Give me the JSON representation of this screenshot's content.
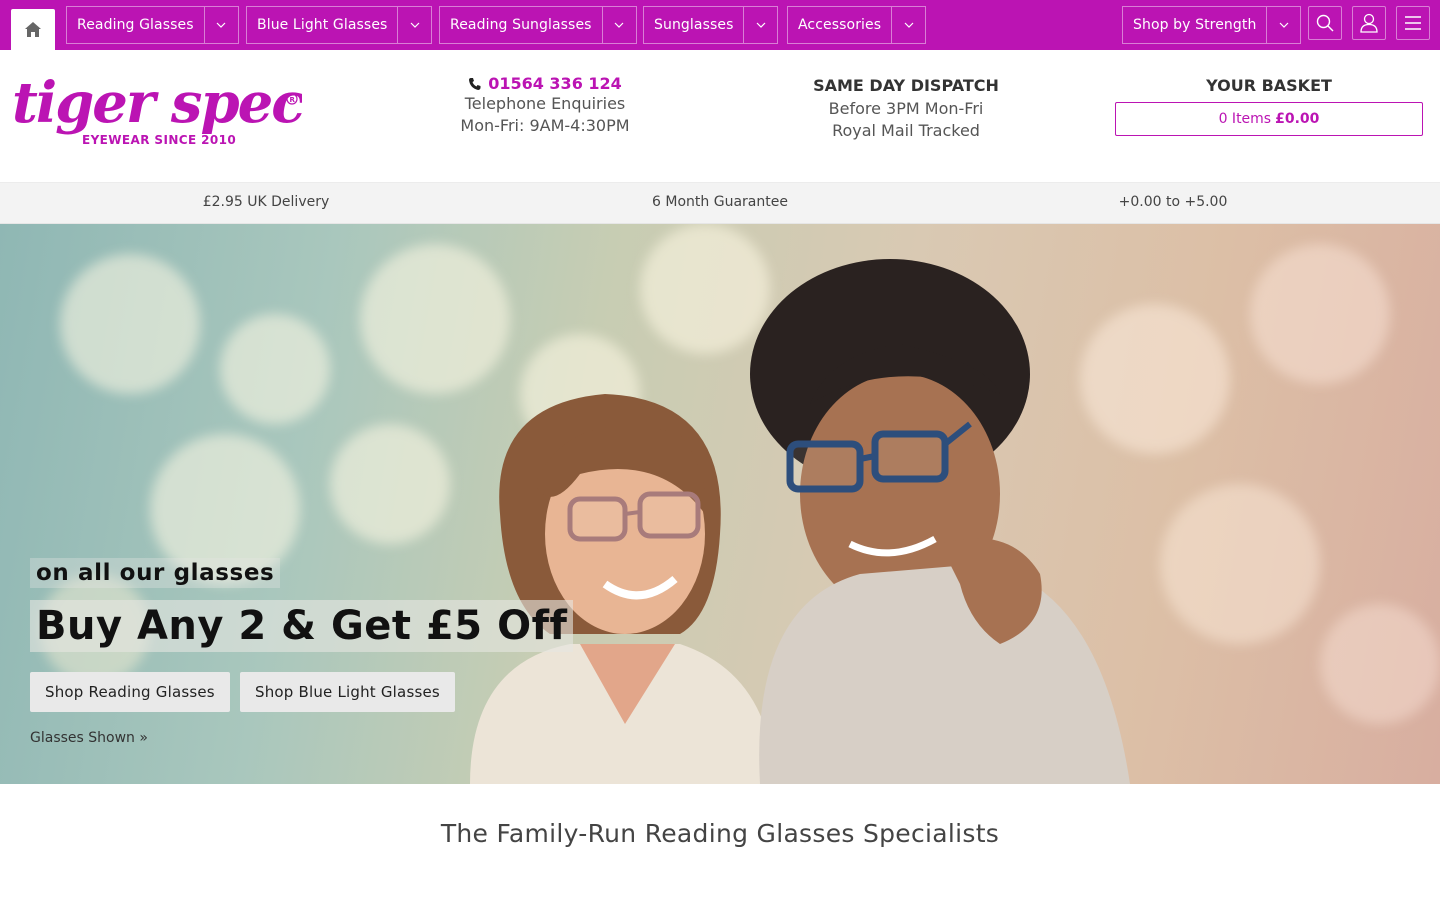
{
  "nav": {
    "home_icon": "home-icon",
    "items": [
      {
        "label": "Reading Glasses"
      },
      {
        "label": "Blue Light Glasses"
      },
      {
        "label": "Reading Sunglasses"
      },
      {
        "label": "Sunglasses"
      },
      {
        "label": "Accessories"
      }
    ],
    "shop_by_strength": "Shop by Strength",
    "icons": [
      "search-icon",
      "user-icon",
      "menu-icon"
    ]
  },
  "brand": {
    "name": "tiger specs",
    "tagline": "EYEWEAR  SINCE 2010",
    "color": "#bb14b3"
  },
  "contact": {
    "phone": "01564 336 124",
    "line1": "Telephone Enquiries",
    "line2": "Mon-Fri: 9AM-4:30PM"
  },
  "dispatch": {
    "title": "SAME DAY DISPATCH",
    "line1": "Before 3PM Mon-Fri",
    "line2": "Royal Mail Tracked"
  },
  "basket": {
    "title": "YOUR BASKET",
    "items": "0 Items",
    "total": "£0.00"
  },
  "usp": {
    "delivery": "£2.95 UK Delivery",
    "guarantee": "6 Month Guarantee",
    "strengths": "+0.00 to +5.00"
  },
  "hero": {
    "subtitle": "on all our glasses",
    "title": "Buy Any 2 & Get £5 Off",
    "btn_reading": "Shop Reading Glasses",
    "btn_bluelight": "Shop Blue Light Glasses",
    "glasses_shown": "Glasses Shown »"
  },
  "tagline": "The Family-Run Reading Glasses Specialists"
}
